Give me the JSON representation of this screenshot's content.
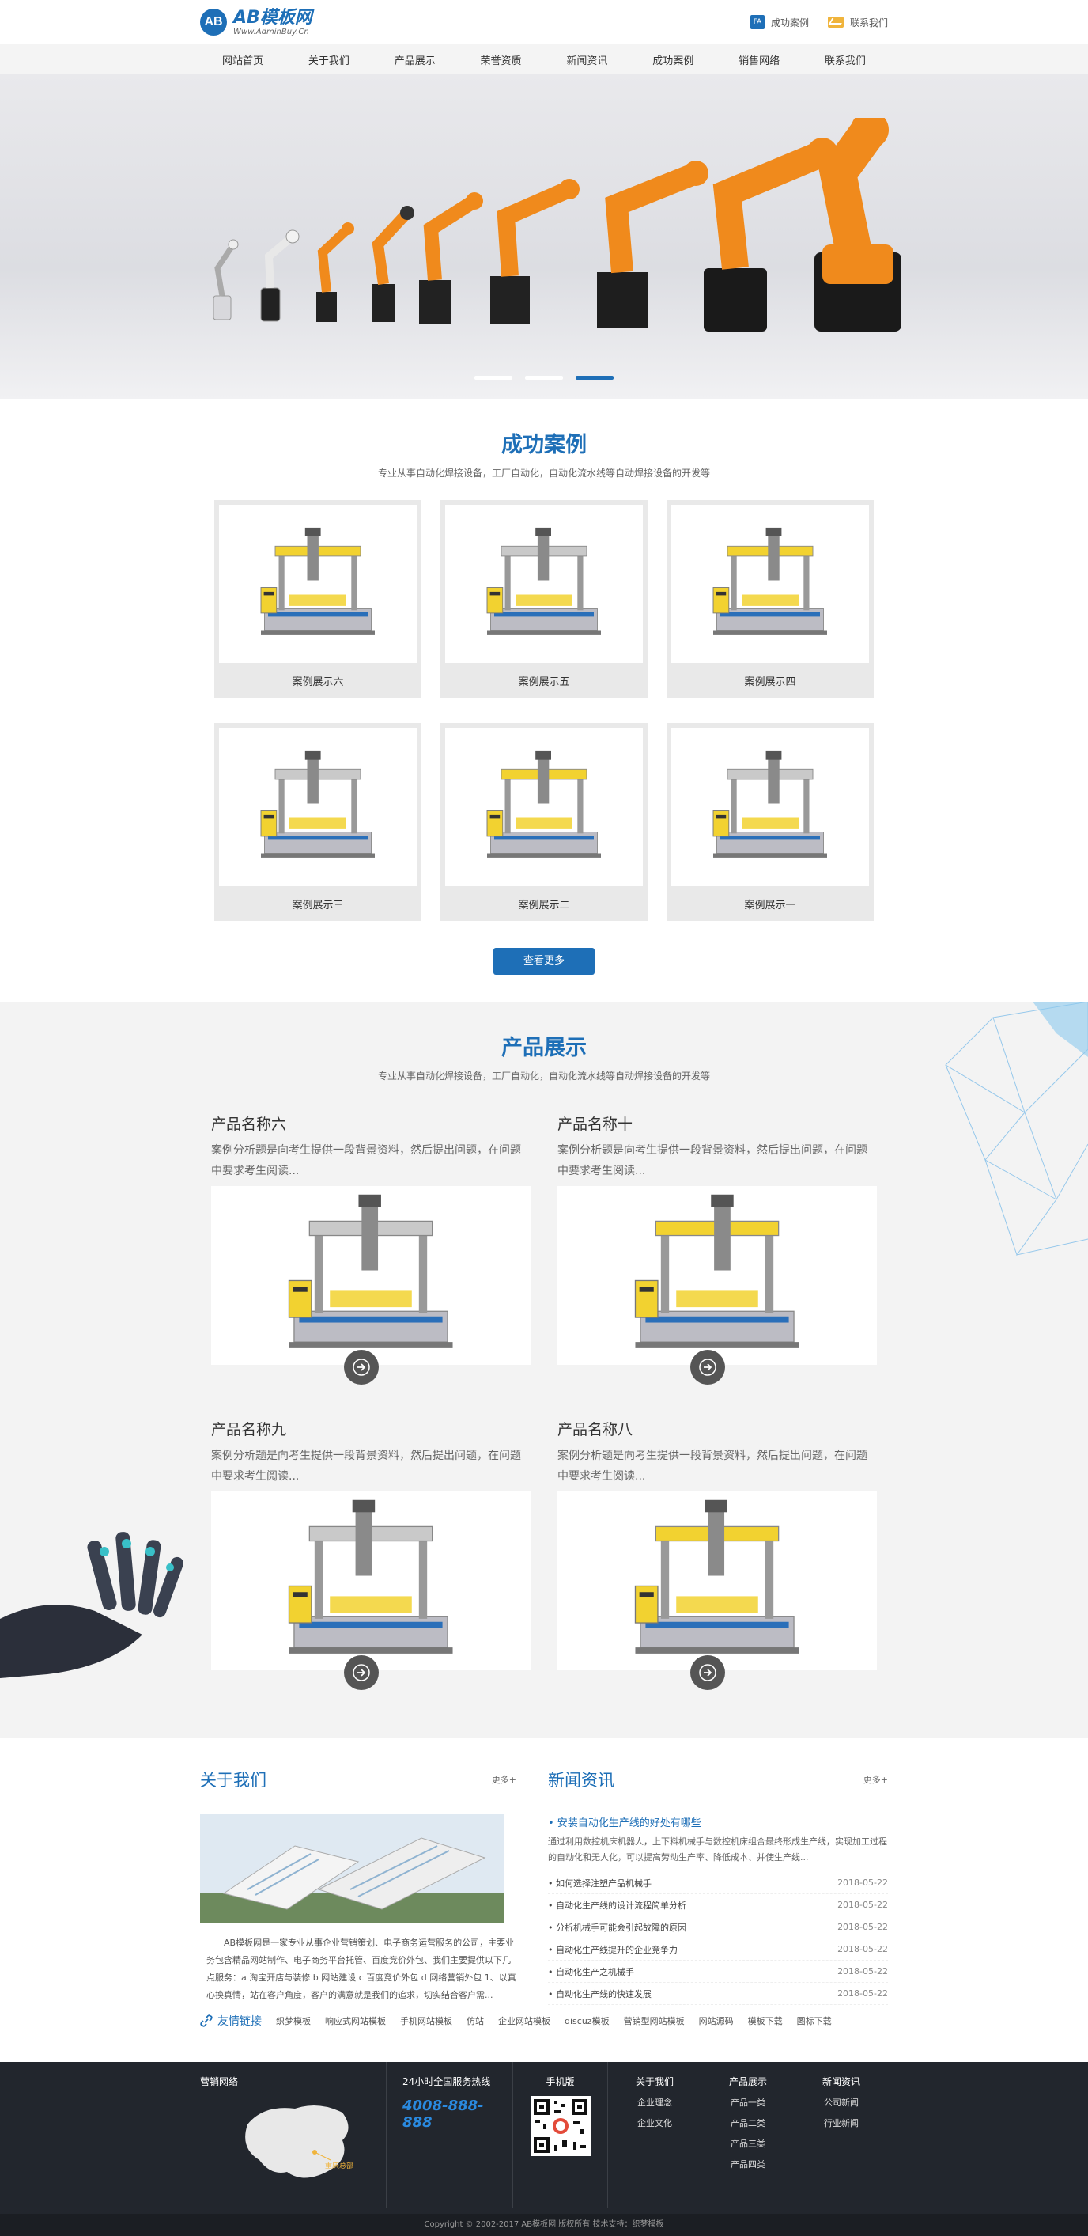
{
  "header": {
    "logo_mark": "AB",
    "logo_name": "AB模板网",
    "logo_url": "Www.AdminBuy.Cn",
    "top_links": [
      {
        "icon": "fa-badge-icon",
        "badge": "FA",
        "label": "成功案例"
      },
      {
        "icon": "mail-icon",
        "label": "联系我们"
      }
    ]
  },
  "nav": [
    "网站首页",
    "关于我们",
    "产品展示",
    "荣誉资质",
    "新闻资讯",
    "成功案例",
    "销售网络",
    "联系我们"
  ],
  "banner": {
    "slides": 3,
    "active": 3
  },
  "cases": {
    "title": "成功案例",
    "subtitle": "专业从事自动化焊接设备，工厂自动化，自动化流水线等自动焊接设备的开发等",
    "items": [
      "案例展示六",
      "案例展示五",
      "案例展示四",
      "案例展示三",
      "案例展示二",
      "案例展示一"
    ],
    "more": "查看更多"
  },
  "products": {
    "title": "产品展示",
    "subtitle": "专业从事自动化焊接设备，工厂自动化，自动化流水线等自动焊接设备的开发等",
    "items": [
      {
        "name": "产品名称六",
        "desc": "案例分析题是向考生提供一段背景资料，然后提出问题，在问题中要求考生阅读..."
      },
      {
        "name": "产品名称十",
        "desc": "案例分析题是向考生提供一段背景资料，然后提出问题，在问题中要求考生阅读..."
      },
      {
        "name": "产品名称九",
        "desc": "案例分析题是向考生提供一段背景资料，然后提出问题，在问题中要求考生阅读..."
      },
      {
        "name": "产品名称八",
        "desc": "案例分析题是向考生提供一段背景资料，然后提出问题，在问题中要求考生阅读..."
      }
    ]
  },
  "about": {
    "title": "关于我们",
    "more": "更多+",
    "text": "AB模板网是一家专业从事企业营销策划、电子商务运营服务的公司，主要业务包含精品网站制作、电子商务平台托管、百度竞价外包、我们主要提供以下几点服务：a 淘宝开店与装修 b 网站建设 c 百度竞价外包 d 网络营销外包 1、以真心换真情，站在客户角度，客户的满意就是我们的追求，切实结合客户需..."
  },
  "news": {
    "title": "新闻资讯",
    "more": "更多+",
    "feature_title": "• 安装自动化生产线的好处有哪些",
    "feature_desc": "通过利用数控机床机器人，上下料机械手与数控机床组合最终形成生产线，实现加工过程的自动化和无人化，可以提高劳动生产率、降低成本、并使生产线...",
    "items": [
      {
        "title": "• 如何选择注塑产品机械手",
        "date": "2018-05-22"
      },
      {
        "title": "• 自动化生产线的设计流程简单分析",
        "date": "2018-05-22"
      },
      {
        "title": "• 分析机械手可能会引起故障的原因",
        "date": "2018-05-22"
      },
      {
        "title": "• 自动化生产线提升的企业竞争力",
        "date": "2018-05-22"
      },
      {
        "title": "• 自动化生产之机械手",
        "date": "2018-05-22"
      },
      {
        "title": "• 自动化生产线的快速发展",
        "date": "2018-05-22"
      }
    ]
  },
  "links": {
    "title": "友情链接",
    "items": [
      "织梦模板",
      "响应式网站模板",
      "手机网站模板",
      "仿站",
      "企业网站模板",
      "discuz模板",
      "营销型网站模板",
      "网站源码",
      "模板下载",
      "图标下载"
    ]
  },
  "footer": {
    "map_title": "营销网络",
    "map_label": "重庆总部",
    "hotline_title": "24小时全国服务热线",
    "hotline": "4008-888-888",
    "qr_title": "手机版",
    "menus": [
      {
        "title": "关于我们",
        "items": [
          "企业理念",
          "企业文化"
        ]
      },
      {
        "title": "产品展示",
        "items": [
          "产品一类",
          "产品二类",
          "产品三类",
          "产品四类"
        ]
      },
      {
        "title": "新闻资讯",
        "items": [
          "公司新闻",
          "行业新闻"
        ]
      }
    ],
    "copyright": "Copyright © 2002-2017 AB模板网 版权所有 技术支持：织梦模板"
  },
  "colors": {
    "brand": "#1e6fb7",
    "footer_bg": "#22262d",
    "robot_orange": "#f08a1c",
    "machine_yellow": "#f2d230"
  }
}
